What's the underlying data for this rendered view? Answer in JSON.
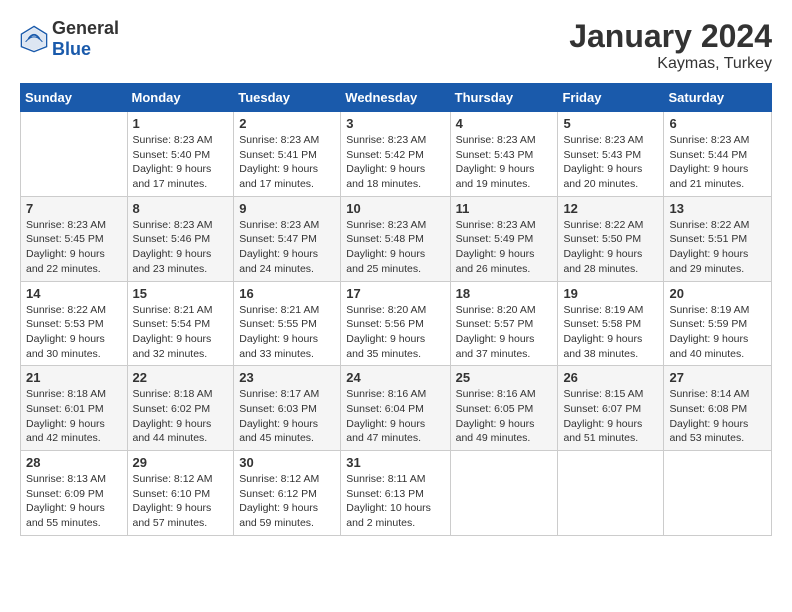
{
  "header": {
    "logo_general": "General",
    "logo_blue": "Blue",
    "month": "January 2024",
    "location": "Kaymas, Turkey"
  },
  "weekdays": [
    "Sunday",
    "Monday",
    "Tuesday",
    "Wednesday",
    "Thursday",
    "Friday",
    "Saturday"
  ],
  "weeks": [
    [
      {
        "day": "",
        "text": ""
      },
      {
        "day": "1",
        "text": "Sunrise: 8:23 AM\nSunset: 5:40 PM\nDaylight: 9 hours\nand 17 minutes."
      },
      {
        "day": "2",
        "text": "Sunrise: 8:23 AM\nSunset: 5:41 PM\nDaylight: 9 hours\nand 17 minutes."
      },
      {
        "day": "3",
        "text": "Sunrise: 8:23 AM\nSunset: 5:42 PM\nDaylight: 9 hours\nand 18 minutes."
      },
      {
        "day": "4",
        "text": "Sunrise: 8:23 AM\nSunset: 5:43 PM\nDaylight: 9 hours\nand 19 minutes."
      },
      {
        "day": "5",
        "text": "Sunrise: 8:23 AM\nSunset: 5:43 PM\nDaylight: 9 hours\nand 20 minutes."
      },
      {
        "day": "6",
        "text": "Sunrise: 8:23 AM\nSunset: 5:44 PM\nDaylight: 9 hours\nand 21 minutes."
      }
    ],
    [
      {
        "day": "7",
        "text": "Sunrise: 8:23 AM\nSunset: 5:45 PM\nDaylight: 9 hours\nand 22 minutes."
      },
      {
        "day": "8",
        "text": "Sunrise: 8:23 AM\nSunset: 5:46 PM\nDaylight: 9 hours\nand 23 minutes."
      },
      {
        "day": "9",
        "text": "Sunrise: 8:23 AM\nSunset: 5:47 PM\nDaylight: 9 hours\nand 24 minutes."
      },
      {
        "day": "10",
        "text": "Sunrise: 8:23 AM\nSunset: 5:48 PM\nDaylight: 9 hours\nand 25 minutes."
      },
      {
        "day": "11",
        "text": "Sunrise: 8:23 AM\nSunset: 5:49 PM\nDaylight: 9 hours\nand 26 minutes."
      },
      {
        "day": "12",
        "text": "Sunrise: 8:22 AM\nSunset: 5:50 PM\nDaylight: 9 hours\nand 28 minutes."
      },
      {
        "day": "13",
        "text": "Sunrise: 8:22 AM\nSunset: 5:51 PM\nDaylight: 9 hours\nand 29 minutes."
      }
    ],
    [
      {
        "day": "14",
        "text": "Sunrise: 8:22 AM\nSunset: 5:53 PM\nDaylight: 9 hours\nand 30 minutes."
      },
      {
        "day": "15",
        "text": "Sunrise: 8:21 AM\nSunset: 5:54 PM\nDaylight: 9 hours\nand 32 minutes."
      },
      {
        "day": "16",
        "text": "Sunrise: 8:21 AM\nSunset: 5:55 PM\nDaylight: 9 hours\nand 33 minutes."
      },
      {
        "day": "17",
        "text": "Sunrise: 8:20 AM\nSunset: 5:56 PM\nDaylight: 9 hours\nand 35 minutes."
      },
      {
        "day": "18",
        "text": "Sunrise: 8:20 AM\nSunset: 5:57 PM\nDaylight: 9 hours\nand 37 minutes."
      },
      {
        "day": "19",
        "text": "Sunrise: 8:19 AM\nSunset: 5:58 PM\nDaylight: 9 hours\nand 38 minutes."
      },
      {
        "day": "20",
        "text": "Sunrise: 8:19 AM\nSunset: 5:59 PM\nDaylight: 9 hours\nand 40 minutes."
      }
    ],
    [
      {
        "day": "21",
        "text": "Sunrise: 8:18 AM\nSunset: 6:01 PM\nDaylight: 9 hours\nand 42 minutes."
      },
      {
        "day": "22",
        "text": "Sunrise: 8:18 AM\nSunset: 6:02 PM\nDaylight: 9 hours\nand 44 minutes."
      },
      {
        "day": "23",
        "text": "Sunrise: 8:17 AM\nSunset: 6:03 PM\nDaylight: 9 hours\nand 45 minutes."
      },
      {
        "day": "24",
        "text": "Sunrise: 8:16 AM\nSunset: 6:04 PM\nDaylight: 9 hours\nand 47 minutes."
      },
      {
        "day": "25",
        "text": "Sunrise: 8:16 AM\nSunset: 6:05 PM\nDaylight: 9 hours\nand 49 minutes."
      },
      {
        "day": "26",
        "text": "Sunrise: 8:15 AM\nSunset: 6:07 PM\nDaylight: 9 hours\nand 51 minutes."
      },
      {
        "day": "27",
        "text": "Sunrise: 8:14 AM\nSunset: 6:08 PM\nDaylight: 9 hours\nand 53 minutes."
      }
    ],
    [
      {
        "day": "28",
        "text": "Sunrise: 8:13 AM\nSunset: 6:09 PM\nDaylight: 9 hours\nand 55 minutes."
      },
      {
        "day": "29",
        "text": "Sunrise: 8:12 AM\nSunset: 6:10 PM\nDaylight: 9 hours\nand 57 minutes."
      },
      {
        "day": "30",
        "text": "Sunrise: 8:12 AM\nSunset: 6:12 PM\nDaylight: 9 hours\nand 59 minutes."
      },
      {
        "day": "31",
        "text": "Sunrise: 8:11 AM\nSunset: 6:13 PM\nDaylight: 10 hours\nand 2 minutes."
      },
      {
        "day": "",
        "text": ""
      },
      {
        "day": "",
        "text": ""
      },
      {
        "day": "",
        "text": ""
      }
    ]
  ]
}
